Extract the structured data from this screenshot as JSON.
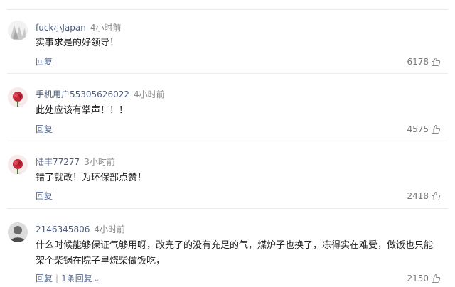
{
  "comments": [
    {
      "user": "fuck小Japan",
      "time": "4小时前",
      "text": "实事求是的好领导！",
      "reply_label": "回复",
      "likes": "6178"
    },
    {
      "user": "手机用户55305626022",
      "time": "4小时前",
      "text": "此处应该有掌声！！！",
      "reply_label": "回复",
      "likes": "4575"
    },
    {
      "user": "陆丰77277",
      "time": "3小时前",
      "text": "错了就改！为环保部点赞！",
      "reply_label": "回复",
      "likes": "2418"
    },
    {
      "user": "2146345806",
      "time": "4小时前",
      "text": "什么时候能够保证气够用呀，改完了的没有充足的气，煤炉子也换了，冻得实在难受，做饭也只能架个柴锅在院子里烧柴做饭吃，",
      "reply_label": "回复",
      "replies_label": "1条回复",
      "likes": "2150"
    }
  ],
  "colors": {
    "username": "#4a5a78",
    "action": "#5a6e95",
    "muted": "#888888"
  },
  "icons": {
    "like": "thumbs-up-icon",
    "expand": "chevron-down-icon"
  }
}
